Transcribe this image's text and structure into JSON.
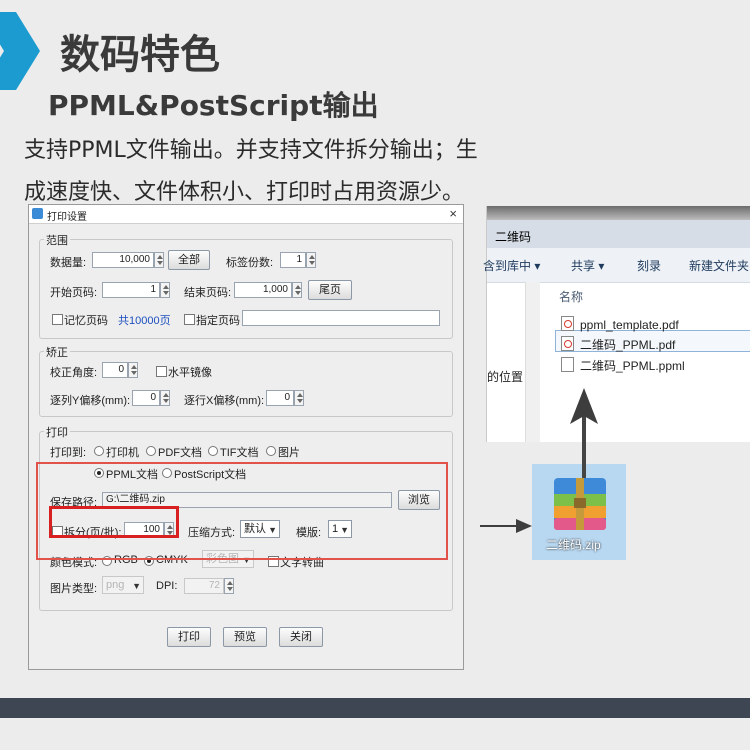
{
  "slide": {
    "title": "数码特色",
    "subtitle": "PPML&PostScript输出",
    "description_line1": "支持PPML文件输出。并支持文件拆分输出；生",
    "description_line2": "成速度快、文件体积小、打印时占用资源少。",
    "colors": {
      "accent": "#1c9bd1",
      "footer": "#3d4652",
      "highlight_red": "#e0524a"
    }
  },
  "dialog": {
    "title": "打印设置",
    "close_icon": "close-icon",
    "range": {
      "group_label": "范围",
      "data_count_label": "数据量:",
      "data_count_value": "10,000",
      "all_button": "全部",
      "label_copies_label": "标签份数:",
      "label_copies_value": "1",
      "start_page_label": "开始页码:",
      "start_page_value": "1",
      "end_page_label": "结束页码:",
      "end_page_value": "1,000",
      "last_page_button": "尾页",
      "remember_page_label": "记忆页码",
      "total_pages": "共10000页",
      "specify_page_label": "指定页码"
    },
    "correction": {
      "group_label": "矫正",
      "angle_label": "校正角度:",
      "angle_value": "0",
      "mirror_label": "水平镜像",
      "y_offset_label": "逐列Y偏移(mm):",
      "y_offset_value": "0",
      "x_offset_label": "逐行X偏移(mm):",
      "x_offset_value": "0"
    },
    "print": {
      "group_label": "打印",
      "print_to_label": "打印到:",
      "targets": [
        "打印机",
        "PDF文档",
        "TIF文档",
        "图片"
      ],
      "formats": [
        "PPML文档",
        "PostScript文档"
      ],
      "selected_format": "PPML文档",
      "save_path_label": "保存路径:",
      "save_path_value": "G:\\二维码.zip",
      "browse_button": "浏览",
      "split_label": "拆分(页/批):",
      "split_value": "100",
      "compress_label": "压缩方式:",
      "compress_value": "默认",
      "template_label": "模版:",
      "template_value": "1",
      "color_mode_label": "颜色模式:",
      "color_modes": [
        "RGB",
        "CMYK"
      ],
      "selected_color_mode": "CMYK",
      "color_disabled_value": "彩色图",
      "text_curve_label": "文字转曲",
      "image_type_label": "图片类型:",
      "image_type_value": "png",
      "dpi_label": "DPI:",
      "dpi_value": "72"
    },
    "buttons": {
      "print": "打印",
      "preview": "预览",
      "close": "关闭"
    }
  },
  "explorer": {
    "title": "二维码",
    "toolbar": [
      "含到库中 ▾",
      "共享 ▾",
      "刻录",
      "新建文件夹"
    ],
    "nav_item": "的位置",
    "column_header": "名称",
    "files": [
      {
        "name": "ppml_template.pdf",
        "icon": "pdf-icon"
      },
      {
        "name": "二维码_PPML.pdf",
        "icon": "pdf-icon"
      },
      {
        "name": "二维码_PPML.ppml",
        "icon": "file-icon"
      }
    ]
  },
  "zip_file": {
    "name": "二维码.zip",
    "icon": "zip-archive-icon"
  }
}
